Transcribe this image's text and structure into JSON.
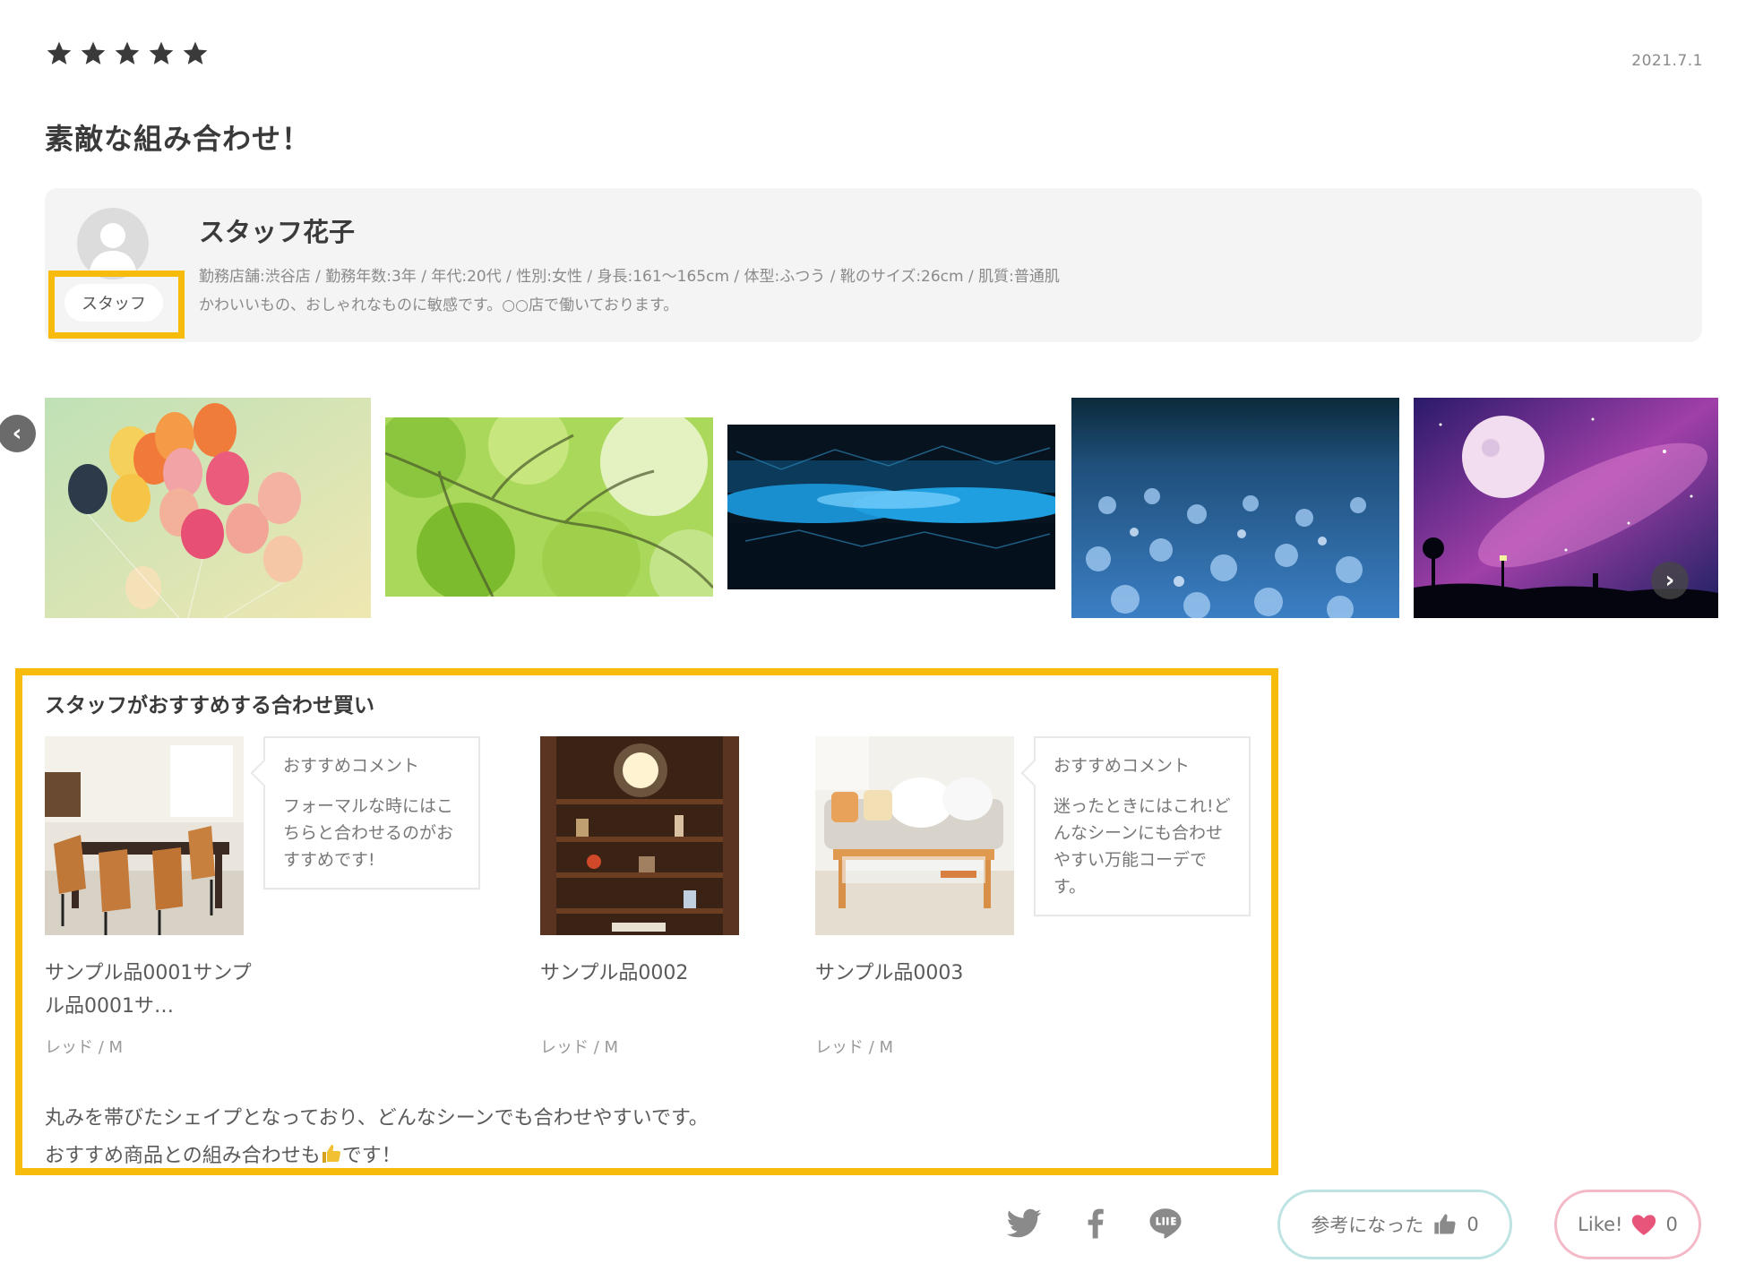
{
  "review": {
    "rating": 5,
    "date": "2021.7.1",
    "title": "素敵な組み合わせ！"
  },
  "staff": {
    "badge": "スタッフ",
    "name": "スタッフ花子",
    "profile": "勤務店舗:渋谷店 / 勤務年数:3年 / 年代:20代 / 性別:女性 / 身長:161～165cm / 体型:ふつう / 靴のサイズ:26cm / 肌質:普通肌",
    "comment": "かわいいもの、おしゃれなものに敏感です。○○店で働いております。",
    "avatar_icon": "user-avatar-icon"
  },
  "gallery": {
    "prev_icon": "chevron-left-icon",
    "next_icon": "chevron-right-icon",
    "images": [
      "balloons",
      "green-leaves",
      "blue-cave",
      "blue-flower-field",
      "galaxy-moon"
    ]
  },
  "recommendations": {
    "heading": "スタッフがおすすめする合わせ買い",
    "bubble_label": "おすすめコメント",
    "products": [
      {
        "name": "サンプル品0001サンプル品0001サ…",
        "variant": "レッド / M",
        "comment": "フォーマルな時にはこちらと合わせるのがおすすめです!"
      },
      {
        "name": "サンプル品0002",
        "variant": "レッド / M",
        "comment": ""
      },
      {
        "name": "サンプル品0003",
        "variant": "レッド / M",
        "comment": "迷ったときにはこれ!どんなシーンにも合わせやすい万能コーデです。"
      }
    ],
    "description_line1": "丸みを帯びたシェイプとなっており、どんなシーンでも合わせやすいです。",
    "description_line2_before": "おすすめ商品との組み合わせも",
    "description_line2_after": "です！"
  },
  "actions": {
    "helpful_label": "参考になった",
    "helpful_count": "0",
    "like_label": "Like!",
    "like_count": "0"
  },
  "colors": {
    "highlight": "#f7bb0b",
    "helpful_border": "#bde3e3",
    "like_border": "#f4b9c6",
    "heart": "#e8557a"
  }
}
